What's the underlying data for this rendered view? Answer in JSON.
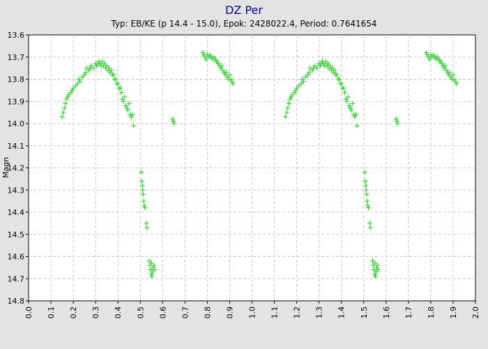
{
  "chart_data": {
    "type": "scatter",
    "title": "DZ Per",
    "subtitle": "Typ: EB/KE (p 14.4 - 15.0), Epok: 2428022.4, Period: 0.7641654",
    "xlabel": "",
    "ylabel": "Magn",
    "xlim": [
      0.0,
      2.0
    ],
    "ylim": [
      13.6,
      14.8
    ],
    "y_inverted": true,
    "grid": true,
    "marker": "plus",
    "color": "#2ecc2e",
    "x_ticks": [
      "0.0",
      "0.1",
      "0.2",
      "0.3",
      "0.4",
      "0.5",
      "0.6",
      "0.7",
      "0.8",
      "0.9",
      "1.0",
      "1.1",
      "1.2",
      "1.3",
      "1.4",
      "1.5",
      "1.6",
      "1.7",
      "1.8",
      "1.9",
      "2.0"
    ],
    "y_ticks": [
      "13.6",
      "13.7",
      "13.8",
      "13.9",
      "14.0",
      "14.1",
      "14.2",
      "14.3",
      "14.4",
      "14.5",
      "14.6",
      "14.7",
      "14.8"
    ],
    "points": [
      [
        0.15,
        13.97
      ],
      [
        0.155,
        13.95
      ],
      [
        0.16,
        13.93
      ],
      [
        0.165,
        13.91
      ],
      [
        0.17,
        13.89
      ],
      [
        0.175,
        13.88
      ],
      [
        0.18,
        13.87
      ],
      [
        0.19,
        13.86
      ],
      [
        0.195,
        13.85
      ],
      [
        0.2,
        13.84
      ],
      [
        0.21,
        13.83
      ],
      [
        0.22,
        13.82
      ],
      [
        0.225,
        13.8
      ],
      [
        0.23,
        13.81
      ],
      [
        0.24,
        13.79
      ],
      [
        0.25,
        13.78
      ],
      [
        0.255,
        13.77
      ],
      [
        0.26,
        13.75
      ],
      [
        0.27,
        13.76
      ],
      [
        0.275,
        13.75
      ],
      [
        0.28,
        13.74
      ],
      [
        0.29,
        13.75
      ],
      [
        0.3,
        13.73
      ],
      [
        0.305,
        13.74
      ],
      [
        0.31,
        13.73
      ],
      [
        0.315,
        13.72
      ],
      [
        0.32,
        13.73
      ],
      [
        0.325,
        13.74
      ],
      [
        0.33,
        13.72
      ],
      [
        0.335,
        13.74
      ],
      [
        0.34,
        13.73
      ],
      [
        0.345,
        13.75
      ],
      [
        0.35,
        13.74
      ],
      [
        0.355,
        13.76
      ],
      [
        0.36,
        13.75
      ],
      [
        0.365,
        13.77
      ],
      [
        0.37,
        13.76
      ],
      [
        0.375,
        13.78
      ],
      [
        0.38,
        13.78
      ],
      [
        0.385,
        13.8
      ],
      [
        0.39,
        13.8
      ],
      [
        0.395,
        13.82
      ],
      [
        0.4,
        13.82
      ],
      [
        0.405,
        13.84
      ],
      [
        0.41,
        13.84
      ],
      [
        0.415,
        13.86
      ],
      [
        0.42,
        13.89
      ],
      [
        0.425,
        13.9
      ],
      [
        0.43,
        13.88
      ],
      [
        0.435,
        13.92
      ],
      [
        0.44,
        13.93
      ],
      [
        0.445,
        13.94
      ],
      [
        0.45,
        13.91
      ],
      [
        0.455,
        13.96
      ],
      [
        0.46,
        13.97
      ],
      [
        0.465,
        13.96
      ],
      [
        0.47,
        14.01
      ],
      [
        0.505,
        14.22
      ],
      [
        0.507,
        14.26
      ],
      [
        0.509,
        14.28
      ],
      [
        0.511,
        14.3
      ],
      [
        0.513,
        14.32
      ],
      [
        0.515,
        14.35
      ],
      [
        0.518,
        14.37
      ],
      [
        0.521,
        14.38
      ],
      [
        0.527,
        14.45
      ],
      [
        0.53,
        14.47
      ],
      [
        0.54,
        14.62
      ],
      [
        0.543,
        14.64
      ],
      [
        0.546,
        14.66
      ],
      [
        0.549,
        14.68
      ],
      [
        0.552,
        14.69
      ],
      [
        0.555,
        14.67
      ],
      [
        0.558,
        14.65
      ],
      [
        0.561,
        14.64
      ],
      [
        0.564,
        14.66
      ],
      [
        0.55,
        14.63
      ],
      [
        0.645,
        13.98
      ],
      [
        0.648,
        13.99
      ],
      [
        0.651,
        14.0
      ],
      [
        0.78,
        13.68
      ],
      [
        0.785,
        13.69
      ],
      [
        0.79,
        13.7
      ],
      [
        0.795,
        13.71
      ],
      [
        0.8,
        13.69
      ],
      [
        0.805,
        13.7
      ],
      [
        0.81,
        13.69
      ],
      [
        0.815,
        13.7
      ],
      [
        0.82,
        13.7
      ],
      [
        0.825,
        13.71
      ],
      [
        0.83,
        13.7
      ],
      [
        0.835,
        13.71
      ],
      [
        0.84,
        13.72
      ],
      [
        0.845,
        13.72
      ],
      [
        0.85,
        13.73
      ],
      [
        0.855,
        13.74
      ],
      [
        0.86,
        13.75
      ],
      [
        0.865,
        13.74
      ],
      [
        0.87,
        13.76
      ],
      [
        0.875,
        13.77
      ],
      [
        0.88,
        13.78
      ],
      [
        0.885,
        13.77
      ],
      [
        0.89,
        13.79
      ],
      [
        0.895,
        13.8
      ],
      [
        0.9,
        13.78
      ],
      [
        0.905,
        13.8
      ],
      [
        0.91,
        13.81
      ],
      [
        0.915,
        13.82
      ]
    ]
  }
}
